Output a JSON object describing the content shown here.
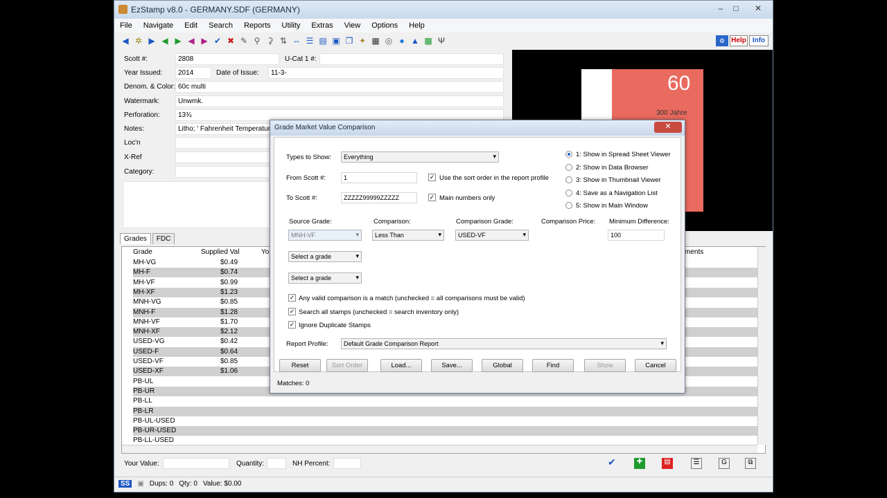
{
  "window": {
    "title": "EzStamp v8.0 - GERMANY.SDF (GERMANY)"
  },
  "menu": [
    "File",
    "Navigate",
    "Edit",
    "Search",
    "Reports",
    "Utility",
    "Extras",
    "View",
    "Options",
    "Help"
  ],
  "topright": {
    "help": "Help",
    "info": "Info"
  },
  "fields": {
    "scott_label": "Scott #:",
    "scott_value": "2808",
    "ucat_label": "U-Cat 1 #:",
    "year_label": "Year Issued:",
    "year_value": "2014",
    "doi_label": "Date of Issue:",
    "doi_value": "11-3-",
    "denom_label": "Denom. & Color:",
    "denom_value": "60c multi",
    "wm_label": "Watermark:",
    "wm_value": "Unwmk.",
    "perf_label": "Perforation:",
    "perf_value": "13¾",
    "notes_label": "Notes:",
    "notes_value": "Litho; ' Fahrenheit Temperature S",
    "loc_label": "Loc'n",
    "xref_label": "X-Ref",
    "cat_label": "Category:"
  },
  "stamp": {
    "value": "60",
    "text": "300 Jahre"
  },
  "tabs": {
    "grades": "Grades",
    "fdc": "FDC"
  },
  "grid": {
    "headers": {
      "grade": "Grade",
      "supplied": "Supplied Val",
      "yo": "Yo",
      "comments": "ments"
    },
    "rows": [
      {
        "grade": "MH-VG",
        "val": "$0.49"
      },
      {
        "grade": "MH-F",
        "val": "$0.74"
      },
      {
        "grade": "MH-VF",
        "val": "$0.99"
      },
      {
        "grade": "MH-XF",
        "val": "$1.23"
      },
      {
        "grade": "MNH-VG",
        "val": "$0.85"
      },
      {
        "grade": "MNH-F",
        "val": "$1.28"
      },
      {
        "grade": "MNH-VF",
        "val": "$1.70"
      },
      {
        "grade": "MNH-XF",
        "val": "$2.12"
      },
      {
        "grade": "USED-VG",
        "val": "$0.42"
      },
      {
        "grade": "USED-F",
        "val": "$0.64"
      },
      {
        "grade": "USED-VF",
        "val": "$0.85"
      },
      {
        "grade": "USED-XF",
        "val": "$1.06"
      },
      {
        "grade": "PB-UL",
        "val": ""
      },
      {
        "grade": "PB-UR",
        "val": ""
      },
      {
        "grade": "PB-LL",
        "val": ""
      },
      {
        "grade": "PB-LR",
        "val": ""
      },
      {
        "grade": "PB-UL-USED",
        "val": ""
      },
      {
        "grade": "PB-UR-USED",
        "val": ""
      },
      {
        "grade": "PB-LL-USED",
        "val": ""
      }
    ]
  },
  "bottom": {
    "your_value": "Your Value:",
    "quantity": "Quantity:",
    "nh": "NH Percent:"
  },
  "status": {
    "dups": "Dups: 0",
    "qty": "Qty: 0",
    "value": "Value: $0.00"
  },
  "dialog": {
    "title": "Grade Market Value Comparison",
    "types_label": "Types to Show:",
    "types_value": "Everything",
    "from_label": "From Scott #:",
    "from_value": "1",
    "to_label": "To Scott #:",
    "to_value": "ZZZZZ99999ZZZZZ",
    "sort_order": "Use the sort order in the report profile",
    "main_only": "Main numbers only",
    "radios": [
      "1: Show in Spread Sheet Viewer",
      "2: Show in Data Browser",
      "3: Show in Thumbnail Viewer",
      "4: Save as a Navigation List",
      "5: Show in Main Window"
    ],
    "source_label": "Source Grade:",
    "source_value": "MNH-VF",
    "comparison_label": "Comparison:",
    "comparison_value": "Less Than",
    "comp_grade_label": "Comparison Grade:",
    "comp_grade_value": "USED-VF",
    "comp_price_label": "Comparison Price:",
    "min_diff_label": "Minimum Difference:",
    "min_diff_value": "100",
    "select1": "Select a grade",
    "select2": "Select a grade",
    "chk1": "Any valid comparison is a match (unchecked = all comparisons must be valid)",
    "chk2": "Search all stamps (unchecked = search inventory only)",
    "chk3": "Ignore Duplicate Stamps",
    "profile_label": "Report Profile:",
    "profile_value": "Default Grade Comparison Report",
    "buttons": {
      "reset": "Reset",
      "sort": "Sort Order",
      "load": "Load...",
      "save": "Save...",
      "global": "Global",
      "find": "Find",
      "show": "Show",
      "cancel": "Cancel"
    },
    "matches": "Matches: 0"
  }
}
